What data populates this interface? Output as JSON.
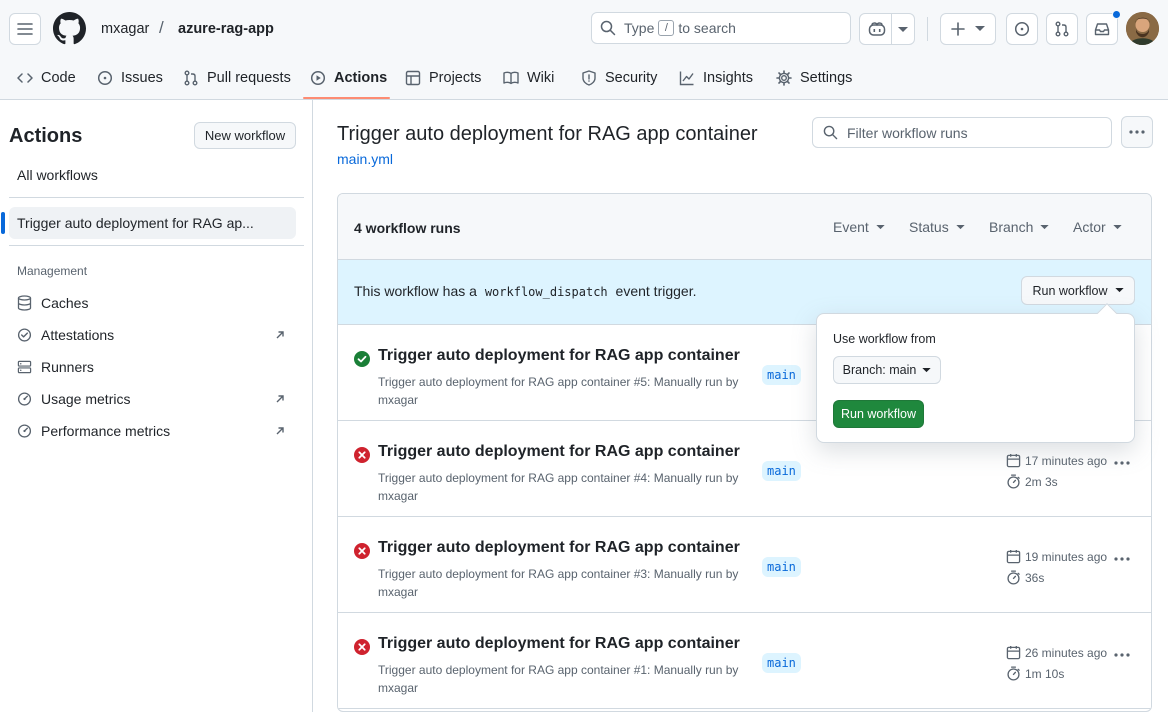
{
  "header": {
    "owner": "mxagar",
    "separator": "/",
    "repo": "azure-rag-app",
    "search_placeholder_pre": "Type",
    "search_key": "/",
    "search_placeholder_post": "to search"
  },
  "tabs": [
    {
      "label": "Code",
      "icon": "code-icon"
    },
    {
      "label": "Issues",
      "icon": "issue-opened-icon"
    },
    {
      "label": "Pull requests",
      "icon": "git-pull-request-icon"
    },
    {
      "label": "Actions",
      "icon": "play-icon"
    },
    {
      "label": "Projects",
      "icon": "table-icon"
    },
    {
      "label": "Wiki",
      "icon": "book-icon"
    },
    {
      "label": "Security",
      "icon": "shield-icon"
    },
    {
      "label": "Insights",
      "icon": "graph-icon"
    },
    {
      "label": "Settings",
      "icon": "gear-icon"
    }
  ],
  "sidebar": {
    "title": "Actions",
    "new_workflow": "New workflow",
    "all_workflows": "All workflows",
    "selected_workflow": "Trigger auto deployment for RAG ap...",
    "management_label": "Management",
    "management": [
      {
        "label": "Caches",
        "icon": "database-icon"
      },
      {
        "label": "Attestations",
        "icon": "verified-icon"
      },
      {
        "label": "Runners",
        "icon": "server-icon"
      },
      {
        "label": "Usage metrics",
        "icon": "meter-icon"
      },
      {
        "label": "Performance metrics",
        "icon": "meter-icon"
      }
    ]
  },
  "main": {
    "title": "Trigger auto deployment for RAG app container",
    "file": "main.yml",
    "filter_placeholder": "Filter workflow runs",
    "runs_count": "4 workflow runs",
    "filters": [
      "Event",
      "Status",
      "Branch",
      "Actor"
    ],
    "dispatch_pre": "This workflow has a",
    "dispatch_code": "workflow_dispatch",
    "dispatch_post": "event trigger.",
    "run_workflow": "Run workflow",
    "runs": [
      {
        "status": "success",
        "title": "Trigger auto deployment for RAG app container",
        "sub": "Trigger auto deployment for RAG app container #5: Manually run by mxagar",
        "branch": "main",
        "time": "",
        "duration": ""
      },
      {
        "status": "failure",
        "title": "Trigger auto deployment for RAG app container",
        "sub": "Trigger auto deployment for RAG app container #4: Manually run by mxagar",
        "branch": "main",
        "time": "17 minutes ago",
        "duration": "2m 3s"
      },
      {
        "status": "failure",
        "title": "Trigger auto deployment for RAG app container",
        "sub": "Trigger auto deployment for RAG app container #3: Manually run by mxagar",
        "branch": "main",
        "time": "19 minutes ago",
        "duration": "36s"
      },
      {
        "status": "failure",
        "title": "Trigger auto deployment for RAG app container",
        "sub": "Trigger auto deployment for RAG app container #1: Manually run by mxagar",
        "branch": "main",
        "time": "26 minutes ago",
        "duration": "1m 10s"
      }
    ]
  },
  "popover": {
    "label": "Use workflow from",
    "branch_select": "Branch: main",
    "run_button": "Run workflow"
  },
  "colors": {
    "accent": "#0969da",
    "success": "#1a7f37",
    "failure": "#cf222e",
    "primary_button": "#1f883d",
    "tab_underline": "#fd8c73",
    "info_bg": "#ddf4ff"
  }
}
